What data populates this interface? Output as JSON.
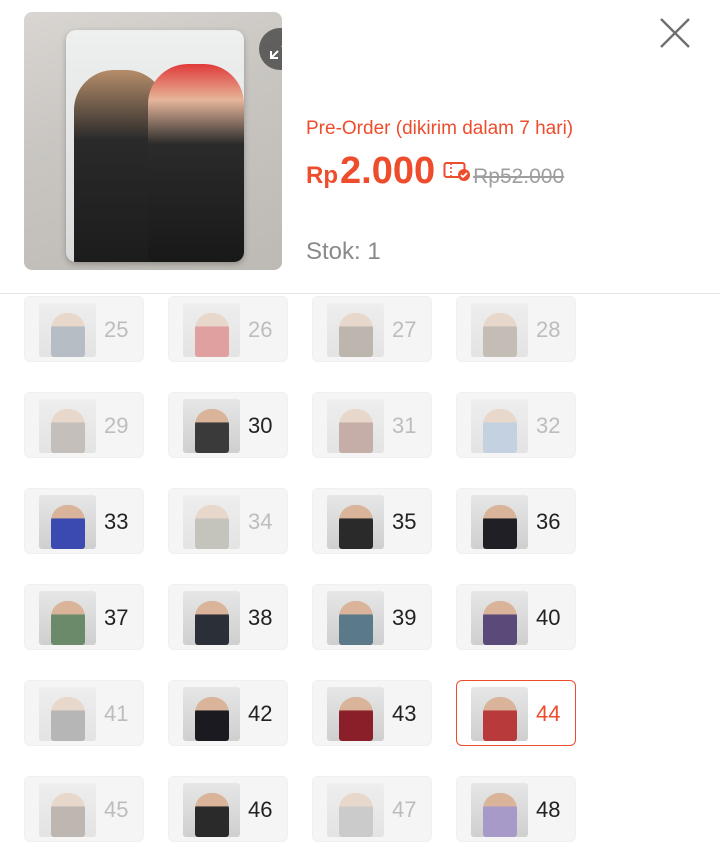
{
  "header": {
    "preorder_text": "Pre-Order (dikirim dalam 7 hari)",
    "price_currency": "Rp",
    "price_value": "2.000",
    "old_price": "Rp52.000",
    "stock_text": "Stok: 1",
    "accent_color": "#ee4d2d"
  },
  "icons": {
    "expand": "expand-icon",
    "close": "close-icon",
    "voucher": "voucher-icon"
  },
  "variants": [
    {
      "label": "25",
      "state": "disabled",
      "tone": "#6d7a8a"
    },
    {
      "label": "26",
      "state": "disabled",
      "tone": "#c83a3a"
    },
    {
      "label": "27",
      "state": "disabled",
      "tone": "#7a6a5a"
    },
    {
      "label": "28",
      "state": "disabled",
      "tone": "#8a7a6a"
    },
    {
      "label": "29",
      "state": "disabled",
      "tone": "#8a7e74"
    },
    {
      "label": "30",
      "state": "available",
      "tone": "#3a3a3a"
    },
    {
      "label": "31",
      "state": "disabled",
      "tone": "#8a5a4a"
    },
    {
      "label": "32",
      "state": "disabled",
      "tone": "#8aa6c8"
    },
    {
      "label": "33",
      "state": "available",
      "tone": "#3a4ab0"
    },
    {
      "label": "34",
      "state": "disabled",
      "tone": "#8a8a7a"
    },
    {
      "label": "35",
      "state": "available",
      "tone": "#2a2a2a"
    },
    {
      "label": "36",
      "state": "available",
      "tone": "#1f1f25"
    },
    {
      "label": "37",
      "state": "available",
      "tone": "#6a8a6a"
    },
    {
      "label": "38",
      "state": "available",
      "tone": "#2a2f38"
    },
    {
      "label": "39",
      "state": "available",
      "tone": "#5a7a8a"
    },
    {
      "label": "40",
      "state": "available",
      "tone": "#5a4a7a"
    },
    {
      "label": "41",
      "state": "disabled",
      "tone": "#6a6a6a"
    },
    {
      "label": "42",
      "state": "available",
      "tone": "#1a1a20"
    },
    {
      "label": "43",
      "state": "available",
      "tone": "#8a1f2a"
    },
    {
      "label": "44",
      "state": "selected",
      "tone": "#b83a3a"
    },
    {
      "label": "45",
      "state": "disabled",
      "tone": "#7a6a60"
    },
    {
      "label": "46",
      "state": "available",
      "tone": "#2a2a2a"
    },
    {
      "label": "47",
      "state": "disabled",
      "tone": "#9a9a9a"
    },
    {
      "label": "48",
      "state": "available",
      "tone": "#a89ac8"
    }
  ]
}
